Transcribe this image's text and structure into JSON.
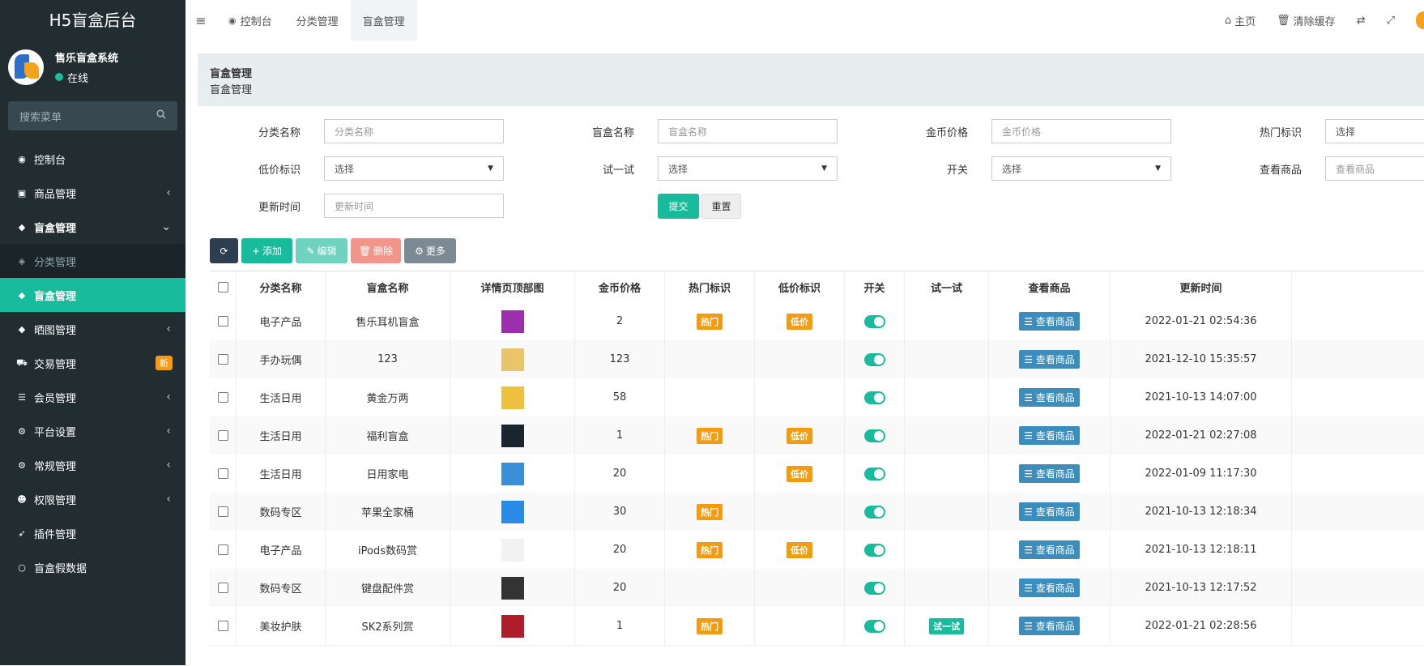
{
  "sidebar": {
    "brand": "H5盲盒后台",
    "user_name": "售乐盲盒系统",
    "user_status": "在线",
    "search_placeholder": "搜索菜单",
    "items": [
      {
        "label": "控制台",
        "icon": "dashboard-icon",
        "arrow": ""
      },
      {
        "label": "商品管理",
        "icon": "shopping-bag-icon",
        "arrow": "‹"
      },
      {
        "label": "盲盒管理",
        "icon": "dropbox-icon",
        "arrow": "⌄"
      },
      {
        "label": "分类管理",
        "icon": "tag-icon",
        "arrow": ""
      },
      {
        "label": "盲盒管理",
        "icon": "dropbox-icon",
        "arrow": ""
      },
      {
        "label": "晒图管理",
        "icon": "dropbox-icon",
        "arrow": "‹"
      },
      {
        "label": "交易管理",
        "icon": "cart-icon",
        "badge": "新"
      },
      {
        "label": "会员管理",
        "icon": "list-icon",
        "arrow": "‹"
      },
      {
        "label": "平台设置",
        "icon": "gears-icon",
        "arrow": "‹"
      },
      {
        "label": "常规管理",
        "icon": "gears-icon",
        "arrow": "‹"
      },
      {
        "label": "权限管理",
        "icon": "group-icon",
        "arrow": "‹"
      },
      {
        "label": "插件管理",
        "icon": "rocket-icon",
        "arrow": ""
      },
      {
        "label": "盲盒假数据",
        "icon": "circle-icon",
        "arrow": ""
      }
    ]
  },
  "topbar": {
    "tabs": [
      "控制台",
      "分类管理",
      "盲盒管理"
    ],
    "right": [
      "主页",
      "清除缓存"
    ]
  },
  "page": {
    "title": "盲盒管理",
    "subtitle": "盲盒管理"
  },
  "form": {
    "category_label": "分类名称",
    "category_ph": "分类名称",
    "name_label": "盲盒名称",
    "name_ph": "盲盒名称",
    "price_label": "金币价格",
    "price_ph": "金币价格",
    "hot_label": "热门标识",
    "hot_val": "选择",
    "low_label": "低价标识",
    "low_val": "选择",
    "try_label": "试一试",
    "try_val": "选择",
    "switch_label": "开关",
    "switch_val": "选择",
    "view_label": "查看商品",
    "view_ph": "查看商品",
    "time_label": "更新时间",
    "time_ph": "更新时间",
    "submit": "提交",
    "reset": "重置"
  },
  "toolbar": {
    "add": "添加",
    "edit": "编辑",
    "delete": "删除",
    "more": "更多"
  },
  "table": {
    "headers": [
      "分类名称",
      "盲盒名称",
      "详情页顶部图",
      "金币价格",
      "热门标识",
      "低价标识",
      "开关",
      "试一试",
      "查看商品",
      "更新时间"
    ],
    "view_label": "查看商品",
    "hot_label": "热门",
    "low_label": "低价",
    "try_label": "试一试",
    "rows": [
      {
        "cat": "电子产品",
        "name": "售乐耳机盲盒",
        "thumb": "#9b2fae",
        "price": "2",
        "hot": true,
        "low": true,
        "try": false,
        "time": "2022-01-21 02:54:36"
      },
      {
        "cat": "手办玩偶",
        "name": "123",
        "thumb": "#e8c46a",
        "price": "123",
        "hot": false,
        "low": false,
        "try": false,
        "time": "2021-12-10 15:35:57"
      },
      {
        "cat": "生活日用",
        "name": "黄金万两",
        "thumb": "#f0c040",
        "price": "58",
        "hot": false,
        "low": false,
        "try": false,
        "time": "2021-10-13 14:07:00"
      },
      {
        "cat": "生活日用",
        "name": "福利盲盒",
        "thumb": "#1a2530",
        "price": "1",
        "hot": true,
        "low": true,
        "try": false,
        "time": "2022-01-21 02:27:08"
      },
      {
        "cat": "生活日用",
        "name": "日用家电",
        "thumb": "#3a8fd8",
        "price": "20",
        "hot": false,
        "low": true,
        "try": false,
        "time": "2022-01-09 11:17:30"
      },
      {
        "cat": "数码专区",
        "name": "苹果全家桶",
        "thumb": "#2a8ae8",
        "price": "30",
        "hot": true,
        "low": false,
        "try": false,
        "time": "2021-10-13 12:18:34"
      },
      {
        "cat": "电子产品",
        "name": "iPods数码赏",
        "thumb": "#f2f2f2",
        "price": "20",
        "hot": true,
        "low": true,
        "try": false,
        "time": "2021-10-13 12:18:11"
      },
      {
        "cat": "数码专区",
        "name": "键盘配件赏",
        "thumb": "#333333",
        "price": "20",
        "hot": false,
        "low": false,
        "try": false,
        "time": "2021-10-13 12:17:52"
      },
      {
        "cat": "美妆护肤",
        "name": "SK2系列赏",
        "thumb": "#b01e2a",
        "price": "1",
        "hot": true,
        "low": false,
        "try": true,
        "time": "2022-01-21 02:28:56"
      }
    ]
  }
}
